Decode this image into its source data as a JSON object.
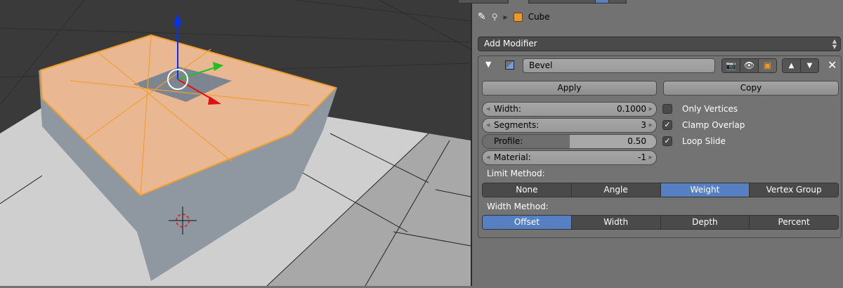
{
  "breadcrumb": {
    "object_name": "Cube"
  },
  "add_modifier": "Add Modifier",
  "modifier": {
    "name": "Bevel",
    "apply_label": "Apply",
    "copy_label": "Copy",
    "fields": [
      {
        "label": "Width:",
        "value": "0.1000"
      },
      {
        "label": "Segments:",
        "value": "3"
      },
      {
        "label": "Profile:",
        "value": "0.50",
        "fraction": 0.5
      },
      {
        "label": "Material:",
        "value": "-1"
      }
    ],
    "checkboxes": [
      {
        "label": "Only Vertices",
        "checked": false
      },
      {
        "label": "Clamp Overlap",
        "checked": true
      },
      {
        "label": "Loop Slide",
        "checked": true
      }
    ],
    "limit_method": {
      "label": "Limit Method:",
      "options": [
        "None",
        "Angle",
        "Weight",
        "Vertex Group"
      ],
      "selected": "Weight"
    },
    "width_method": {
      "label": "Width Method:",
      "options": [
        "Offset",
        "Width",
        "Depth",
        "Percent"
      ],
      "selected": "Offset"
    }
  },
  "colors": {
    "selected": "#5680c2",
    "selection_outline": "#f0a030",
    "face_select": "#e9b892"
  }
}
